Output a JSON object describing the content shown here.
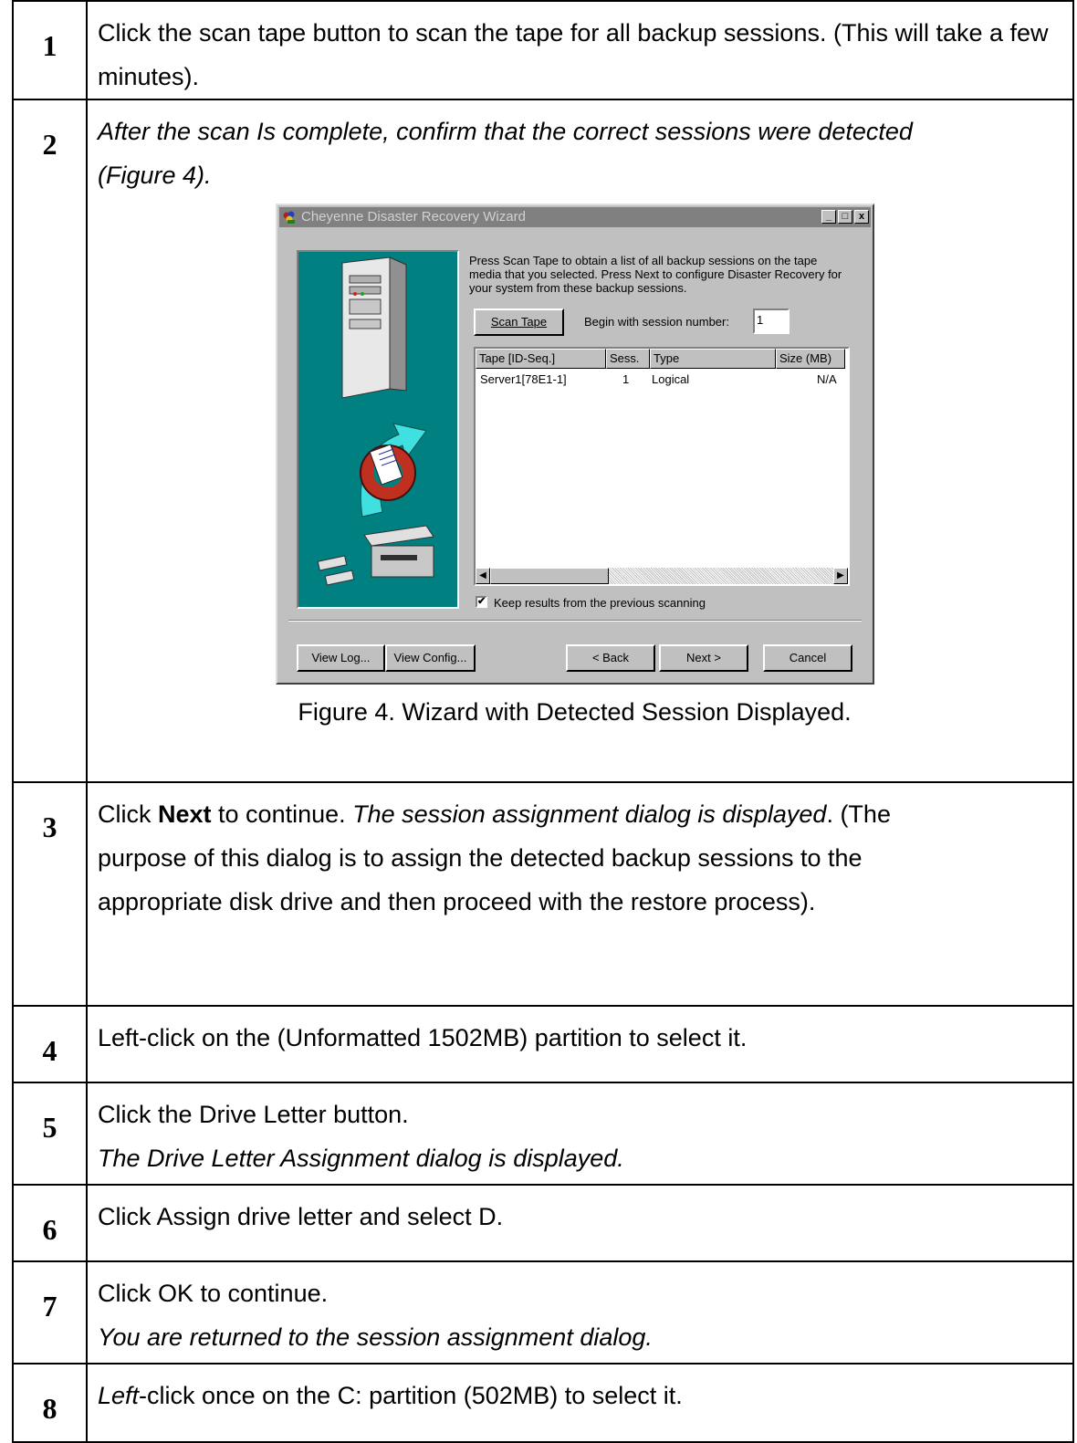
{
  "steps": [
    {
      "num": "1",
      "text": "Click the scan tape button to scan the tape for all backup sessions. (This will take a few minutes)."
    },
    {
      "num": "2",
      "text": "After the scan Is complete, confirm that the correct sessions were detected (Figure 4).",
      "caption": "Figure 4. Wizard with Detected Session Displayed."
    },
    {
      "num": "3",
      "pre": "Click ",
      "bold": "Next",
      "mid": " to continue. ",
      "italic": "The session assignment dialog is displayed",
      "post": ". (The purpose of this dialog is to assign the detected backup sessions to the appropriate disk drive and then proceed with the restore process)."
    },
    {
      "num": "4",
      "text": "Left-click on the (Unformatted 1502MB) partition to select it."
    },
    {
      "num": "5",
      "line1": "Click the Drive Letter button.",
      "line2": "The Drive Letter Assignment dialog is displayed."
    },
    {
      "num": "6",
      "text": "Click Assign drive letter and select D."
    },
    {
      "num": "7",
      "line1": "Click OK to continue.",
      "line2": "You are returned to the session assignment dialog."
    },
    {
      "num": "8",
      "italic": "Left",
      "text": "-click once on the C: partition (502MB) to select it."
    }
  ],
  "dialog": {
    "title": "Cheyenne Disaster Recovery Wizard",
    "minimize": "_",
    "maximize": "□",
    "close": "x",
    "instructions": "Press Scan Tape to obtain a list of all backup sessions on the tape media that you selected. Press Next to configure Disaster Recovery for your system from these backup sessions.",
    "scan_button": "Scan Tape",
    "begin_label": "Begin with session number:",
    "begin_value": "1",
    "columns": [
      "Tape [ID-Seq.]",
      "Sess.",
      "Type",
      "Size (MB)"
    ],
    "rows": [
      {
        "tape": "Server1[78E1-1]",
        "sess": "1",
        "type": "Logical",
        "size": "N/A"
      }
    ],
    "keep_results_label": "Keep results from the previous scanning",
    "keep_results_checked": "✔",
    "view_log": "View Log...",
    "view_config": "View Config...",
    "back": "< Back",
    "next": "Next >",
    "cancel": "Cancel"
  }
}
